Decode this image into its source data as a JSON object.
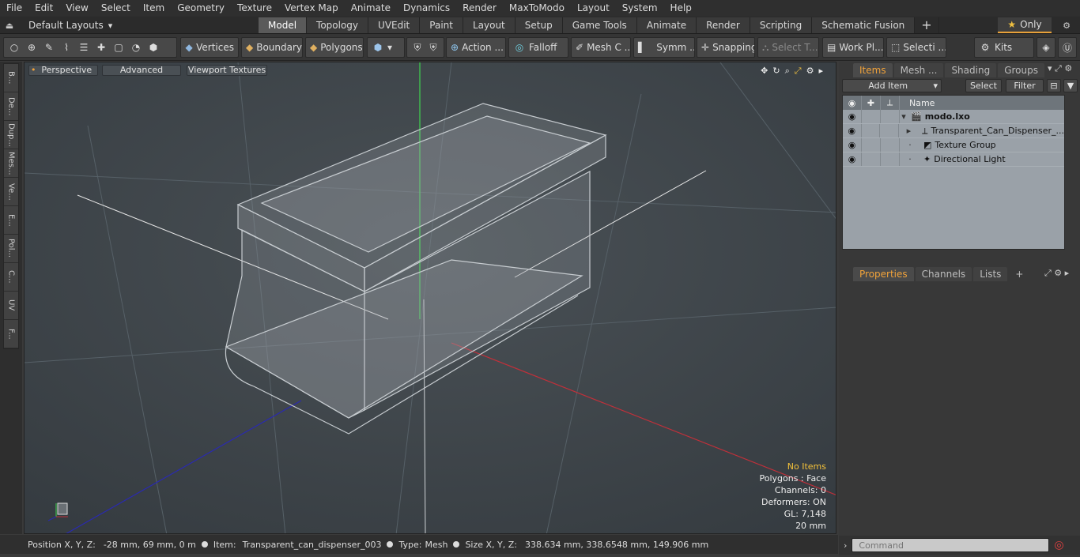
{
  "menu": [
    "File",
    "Edit",
    "View",
    "Select",
    "Item",
    "Geometry",
    "Texture",
    "Vertex Map",
    "Animate",
    "Dynamics",
    "Render",
    "MaxToModo",
    "Layout",
    "System",
    "Help"
  ],
  "layouts": {
    "label": "Default Layouts"
  },
  "tabs": [
    "Model",
    "Topology",
    "UVEdit",
    "Paint",
    "Layout",
    "Setup",
    "Game Tools",
    "Animate",
    "Render",
    "Scripting",
    "Schematic Fusion"
  ],
  "active_tab": "Model",
  "only_label": "Only",
  "toolbar": {
    "vertices": "Vertices",
    "boundary": "Boundary",
    "polygons": "Polygons",
    "action": "Action ...",
    "falloff": "Falloff",
    "meshc": "Mesh C ...",
    "symm": "Symm ...",
    "snapping": "Snapping",
    "selectt": "Select T...",
    "workpl": "Work Pl...",
    "selecti": "Selecti ...",
    "kits": "Kits"
  },
  "left_tabs": [
    "B...",
    "De...",
    "Dup...",
    "Mes...",
    "Ve...",
    "E...",
    "Pol...",
    "C...",
    "UV",
    "F..."
  ],
  "viewport": {
    "perspective": "Perspective",
    "advanced": "Advanced",
    "textures": "Viewport Textures"
  },
  "stats": {
    "no_items": "No Items",
    "polygons": "Polygons : Face",
    "channels": "Channels: 0",
    "deformers": "Deformers: ON",
    "gl": "GL: 7,148",
    "scale": "20 mm"
  },
  "status": {
    "position_label": "Position X, Y, Z:",
    "position": "-28 mm, 69 mm, 0 m",
    "item_label": "Item:",
    "item": "Transparent_can_dispenser_003",
    "type_label": "Type:",
    "type": "Mesh",
    "size_label": "Size X, Y, Z:",
    "size": "338.634 mm, 338.6548 mm, 149.906 mm"
  },
  "panel": {
    "tabs": [
      "Items",
      "Mesh ...",
      "Shading",
      "Groups"
    ],
    "add_item": "Add Item",
    "select": "Select",
    "filter": "Filter",
    "name_col": "Name",
    "items": [
      {
        "name": "modo.lxo"
      },
      {
        "name": "Transparent_Can_Dispenser_..."
      },
      {
        "name": "Texture Group"
      },
      {
        "name": "Directional Light"
      }
    ],
    "bottom_tabs": [
      "Properties",
      "Channels",
      "Lists"
    ],
    "command_placeholder": "Command"
  },
  "colors": {
    "accent": "#f0a23a",
    "axis_x": "#c0303a",
    "axis_y": "#48c848",
    "axis_z": "#2a2ab0"
  }
}
